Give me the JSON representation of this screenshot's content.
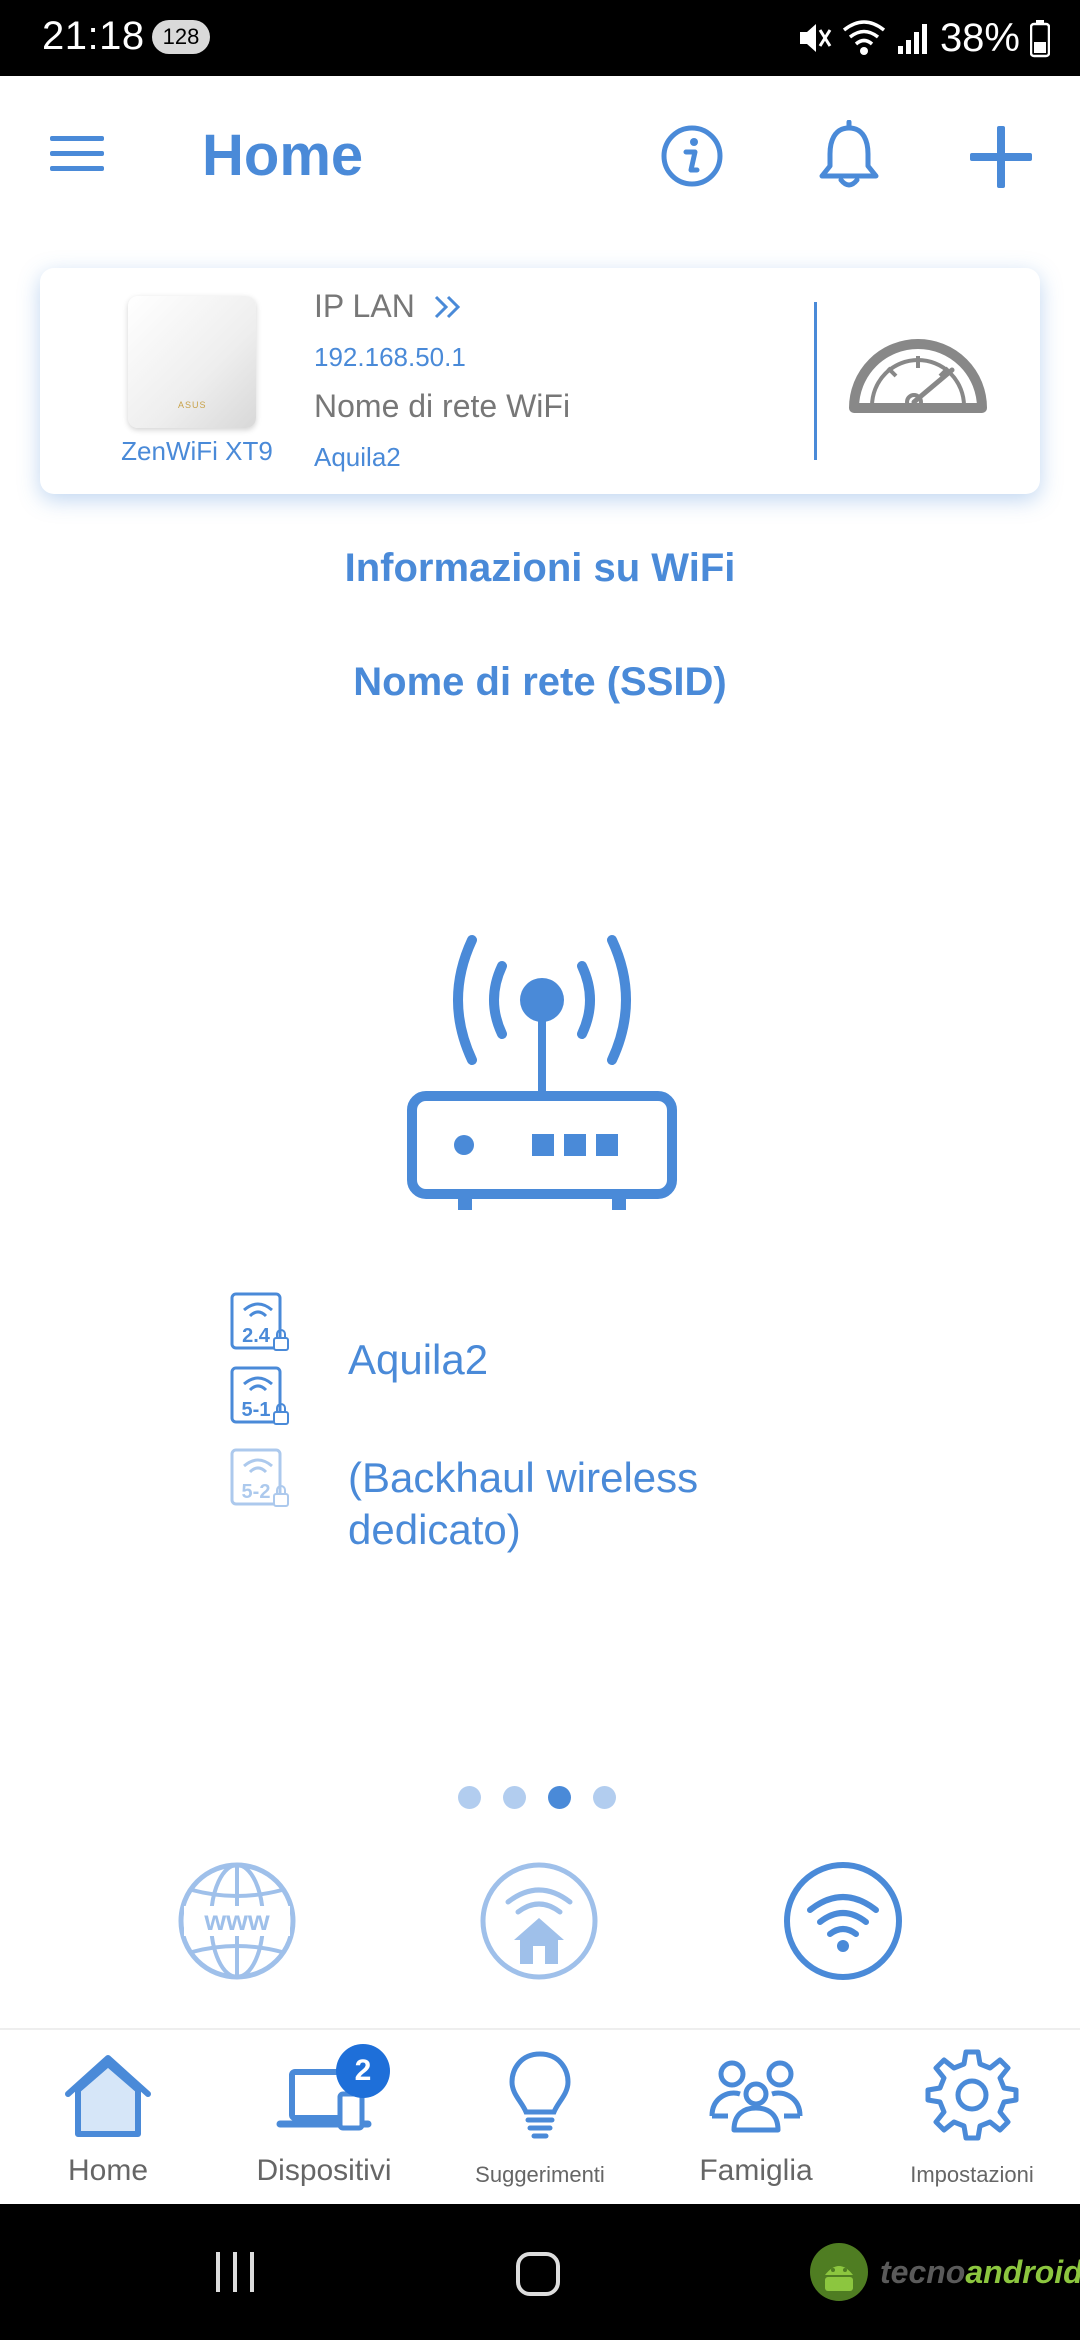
{
  "status_bar": {
    "time": "21:18",
    "badge": "128",
    "battery": "38%"
  },
  "header": {
    "title": "Home",
    "icons": [
      "menu-icon",
      "info-icon",
      "bell-icon",
      "plus-icon"
    ]
  },
  "device_card": {
    "model": "ZenWiFi XT9",
    "router_logo": "ASUS",
    "ip_label": "IP LAN",
    "ip_value": "192.168.50.1",
    "network_label": "Nome di rete WiFi",
    "network_value": "Aquila2",
    "action_icon": "speedometer-icon"
  },
  "wifi_info": {
    "title": "Informazioni su WiFi",
    "ssid_title": "Nome di rete (SSID)",
    "bands": [
      {
        "label": "2.4",
        "icon": "wifi-band-icon"
      },
      {
        "label": "5-1",
        "icon": "wifi-band-icon"
      },
      {
        "label": "5-2",
        "icon": "wifi-band-icon"
      }
    ],
    "ssid_name": "Aquila2",
    "backhaul_text": "(Backhaul wireless dedicato)"
  },
  "pager": {
    "count": 4,
    "active_index": 2
  },
  "feature_icons": [
    "www-globe-icon",
    "home-wifi-icon",
    "wifi-icon"
  ],
  "bottom_nav": {
    "items": [
      {
        "label": "Home",
        "icon": "home-icon"
      },
      {
        "label": "Dispositivi",
        "icon": "laptop-icon",
        "badge": "2"
      },
      {
        "label": "Suggerimenti",
        "icon": "lightbulb-icon"
      },
      {
        "label": "Famiglia",
        "icon": "family-icon"
      },
      {
        "label": "Impostazioni",
        "icon": "gear-icon"
      }
    ]
  },
  "watermark": {
    "prefix": "tecno",
    "suffix": "android"
  },
  "colors": {
    "accent": "#4a8ad8",
    "light_accent": "#b2cdef",
    "badge": "#1e6fd9",
    "gray": "#777777"
  }
}
